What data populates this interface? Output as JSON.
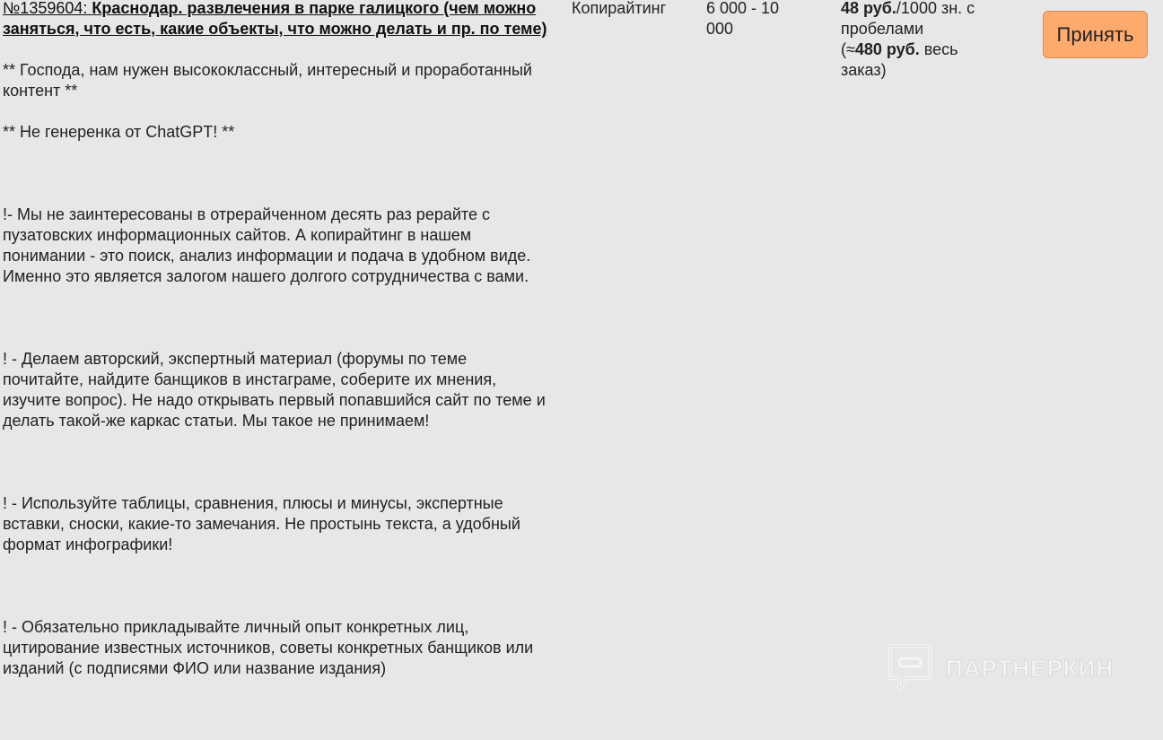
{
  "order": {
    "number": "№1359604:",
    "title": "Краснодар. развлечения в парке галицкого (чем можно заняться, что есть, какие объекты, что можно делать и пр. по теме)",
    "paragraphs": [
      "** Господа, нам нужен высококлассный, интересный и проработанный контент **",
      "** Не генеренка от ChatGPT! **",
      "!- Мы не заинтересованы в отрерайченном десять раз рерайте с пузатовских информационных сайтов. А копирайтинг в нашем понимании - это поиск, анализ информации и подача в удобном виде. Именно это является залогом нашего долгого сотрудничества с вами.",
      "! - Делаем авторский, экспертный материал (форумы по теме почитайте, найдите банщиков в инстаграме, соберите их мнения, изучите вопрос). Не надо открывать первый попавшийся сайт по теме и делать такой-же каркас статьи. Мы такое не принимаем!",
      "! - Используйте таблицы, сравнения, плюсы и минусы, экспертные вставки, сноски, какие-то замечания. Не простынь текста, а удобный формат инфографики!",
      "! - Обязательно прикладывайте личный опыт конкретных лиц, цитирование известных источников, советы конкретных банщиков или изданий (с подписями ФИО или название издания)"
    ],
    "category": "Копирайтинг",
    "volume": "6 000 - 10 000",
    "price": {
      "rate": "48 руб.",
      "rate_unit": "/1000 зн. с пробелами",
      "total_prefix": "(≈",
      "total": "480 руб.",
      "total_suffix": " весь заказ)"
    },
    "accept_label": "Принять"
  },
  "watermark": {
    "text": "ПАРТНЕРКИН",
    "icon": "chat-bubble-logo-icon"
  }
}
